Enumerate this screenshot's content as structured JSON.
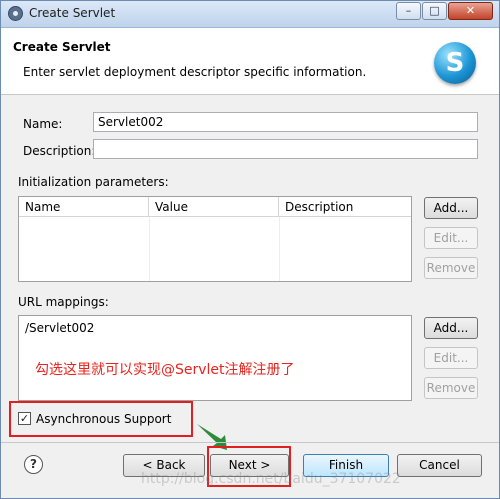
{
  "window": {
    "title": "Create Servlet",
    "buttons": {
      "minimize": "–",
      "maximize": "□",
      "close": "✕"
    }
  },
  "header": {
    "title": "Create Servlet",
    "description": "Enter servlet deployment descriptor specific information.",
    "logo_letter": "S"
  },
  "form": {
    "name_label": "Name:",
    "name_value": "Servlet002",
    "description_label": "Description:",
    "description_value": ""
  },
  "init_params": {
    "label": "Initialization parameters:",
    "columns": [
      "Name",
      "Value",
      "Description"
    ],
    "buttons": {
      "add": "Add...",
      "edit": "Edit...",
      "remove": "Remove"
    }
  },
  "url_mappings": {
    "label": "URL mappings:",
    "items": [
      "/Servlet002"
    ],
    "buttons": {
      "add": "Add...",
      "edit": "Edit...",
      "remove": "Remove"
    }
  },
  "annotation": "勾选这里就可以实现@Servlet注解注册了",
  "async_support": {
    "label": "Asynchronous Support",
    "checked": true,
    "check_glyph": "✓"
  },
  "footer": {
    "help": "?",
    "back": "< Back",
    "next": "Next >",
    "finish": "Finish",
    "cancel": "Cancel"
  },
  "watermark": "http://blog.csdn.net/baidu_37107022",
  "colors": {
    "highlight": "#e02020",
    "annotation": "#e8241e",
    "arrow": "#2e8b3a"
  }
}
